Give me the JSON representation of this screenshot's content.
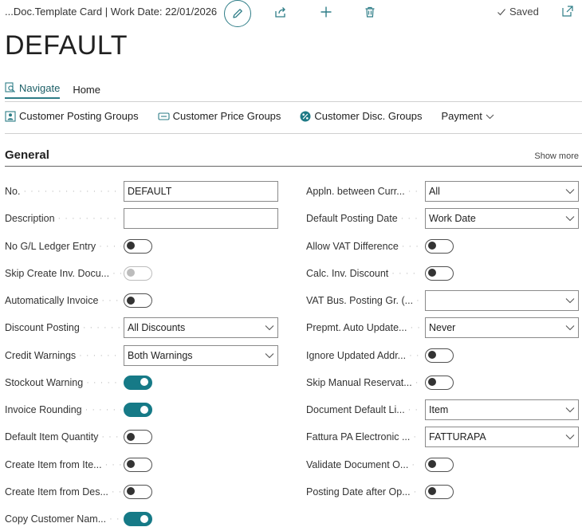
{
  "header": {
    "breadcrumb": "...Doc.Template Card | Work Date: 22/01/2026",
    "saved_label": "Saved"
  },
  "page": {
    "title": "DEFAULT"
  },
  "tabs": [
    {
      "label": "Navigate",
      "active": true
    },
    {
      "label": "Home",
      "active": false
    }
  ],
  "actions": [
    {
      "label": "Customer Posting Groups",
      "icon": "customer-posting-groups-icon"
    },
    {
      "label": "Customer Price Groups",
      "icon": "customer-price-groups-icon"
    },
    {
      "label": "Customer Disc. Groups",
      "icon": "percent-icon"
    },
    {
      "label": "Payment",
      "icon": "chevron-down-icon"
    }
  ],
  "section": {
    "title": "General",
    "show_more": "Show more"
  },
  "left_fields": [
    {
      "label": "No.",
      "type": "input",
      "value": "DEFAULT"
    },
    {
      "label": "Description",
      "type": "input",
      "value": ""
    },
    {
      "label": "No G/L Ledger Entry",
      "type": "toggle",
      "value": "off"
    },
    {
      "label": "Skip Create Inv. Docu...",
      "type": "toggle",
      "value": "disabled"
    },
    {
      "label": "Automatically Invoice",
      "type": "toggle",
      "value": "off"
    },
    {
      "label": "Discount Posting",
      "type": "select",
      "value": "All Discounts"
    },
    {
      "label": "Credit Warnings",
      "type": "select",
      "value": "Both Warnings"
    },
    {
      "label": "Stockout Warning",
      "type": "toggle",
      "value": "on"
    },
    {
      "label": "Invoice Rounding",
      "type": "toggle",
      "value": "on"
    },
    {
      "label": "Default Item Quantity",
      "type": "toggle",
      "value": "off"
    },
    {
      "label": "Create Item from Ite...",
      "type": "toggle",
      "value": "off"
    },
    {
      "label": "Create Item from Des...",
      "type": "toggle",
      "value": "off"
    },
    {
      "label": "Copy Customer Nam...",
      "type": "toggle",
      "value": "on"
    }
  ],
  "right_fields": [
    {
      "label": "Appln. between Curr...",
      "type": "select",
      "value": "All"
    },
    {
      "label": "Default Posting Date",
      "type": "select",
      "value": "Work Date"
    },
    {
      "label": "Allow VAT Difference",
      "type": "toggle",
      "value": "off"
    },
    {
      "label": "Calc. Inv. Discount",
      "type": "toggle",
      "value": "off"
    },
    {
      "label": "VAT Bus. Posting Gr. (...",
      "type": "select",
      "value": ""
    },
    {
      "label": "Prepmt. Auto Update...",
      "type": "select",
      "value": "Never"
    },
    {
      "label": "Ignore Updated Addr...",
      "type": "toggle",
      "value": "off"
    },
    {
      "label": "Skip Manual Reservat...",
      "type": "toggle",
      "value": "off"
    },
    {
      "label": "Document Default Li...",
      "type": "select",
      "value": "Item"
    },
    {
      "label": "Fattura PA Electronic ...",
      "type": "select",
      "value": "FATTURAPA"
    },
    {
      "label": "Validate Document O...",
      "type": "toggle",
      "value": "off"
    },
    {
      "label": "Posting Date after Op...",
      "type": "toggle",
      "value": "off"
    }
  ]
}
